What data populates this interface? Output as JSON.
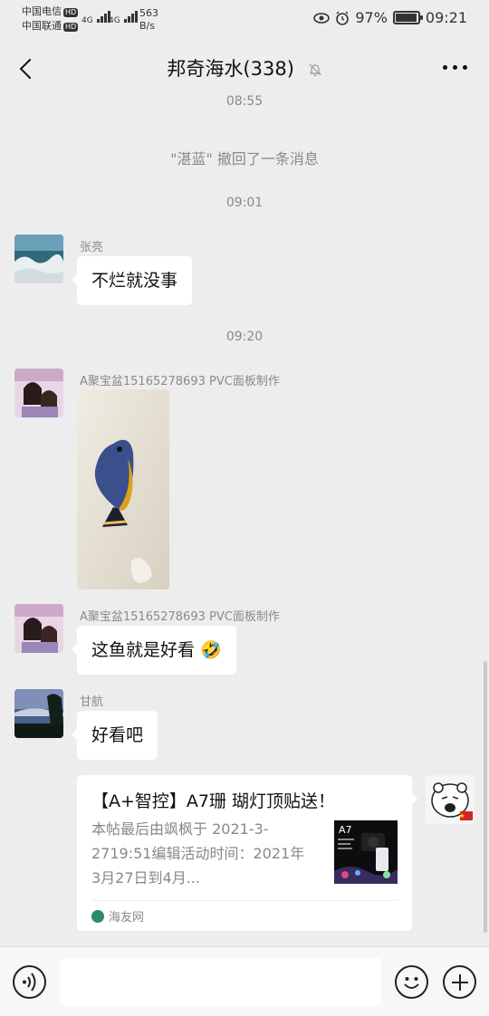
{
  "status_bar": {
    "carrier1": "中国电信",
    "carrier2": "中国联通",
    "hd": "HD",
    "signal1": "4G",
    "signal2": "4G",
    "net_speed_value": "563",
    "net_speed_unit": "B/s",
    "battery_percent": "97%",
    "battery_level": 0.97,
    "time": "09:21"
  },
  "header": {
    "title": "邦奇海水(338)"
  },
  "chat": {
    "time_0855": "08:55",
    "recall_notice": "\"湛蓝\" 撤回了一条消息",
    "time_0901": "09:01",
    "msg1": {
      "sender": "张亮",
      "text": "不烂就没事"
    },
    "time_0920": "09:20",
    "msg2": {
      "sender": "A聚宝盆15165278693 PVC面板制作"
    },
    "msg3": {
      "sender": "A聚宝盆15165278693 PVC面板制作",
      "text": "这鱼就是好看 🤣"
    },
    "msg4": {
      "sender": "甘航",
      "text": "好看吧"
    },
    "card": {
      "title": "【A+智控】A7珊 瑚灯顶贴送！",
      "desc": "本帖最后由飒枫于 2021-3-2719:51编辑活动时间：2021年3月27日到4月...",
      "thumb_label": "A7",
      "source": "海友网"
    }
  },
  "input_bar": {
    "placeholder": ""
  },
  "colors": {
    "background": "#ededed",
    "bubble": "#ffffff",
    "meta_text": "#8a8a8a"
  }
}
